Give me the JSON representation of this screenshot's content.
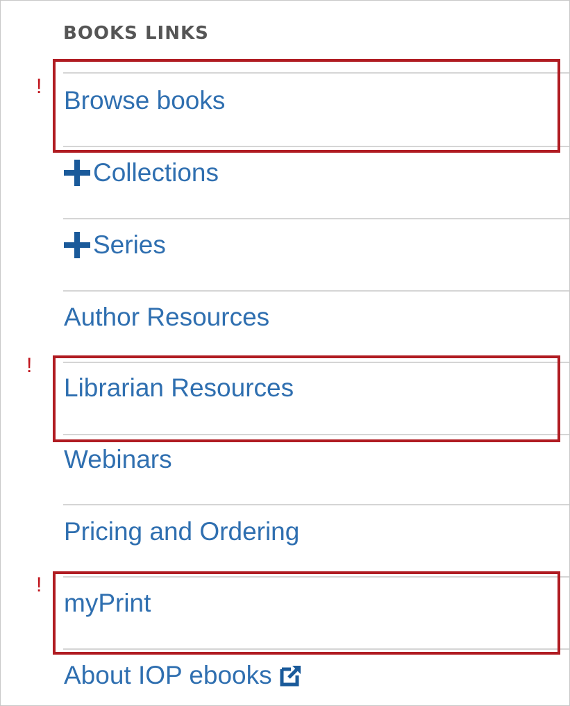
{
  "panel": {
    "heading": "BOOKS LINKS"
  },
  "nav": {
    "items": [
      {
        "label": "Browse books",
        "expandable": false,
        "external": false,
        "highlighted": true
      },
      {
        "label": "Collections",
        "expandable": true,
        "external": false,
        "highlighted": false
      },
      {
        "label": "Series",
        "expandable": true,
        "external": false,
        "highlighted": false
      },
      {
        "label": "Author Resources",
        "expandable": false,
        "external": false,
        "highlighted": false
      },
      {
        "label": "Librarian Resources",
        "expandable": false,
        "external": false,
        "highlighted": true
      },
      {
        "label": "Webinars",
        "expandable": false,
        "external": false,
        "highlighted": false
      },
      {
        "label": "Pricing and Ordering",
        "expandable": false,
        "external": false,
        "highlighted": false
      },
      {
        "label": "myPrint",
        "expandable": false,
        "external": false,
        "highlighted": true
      },
      {
        "label": "About IOP ebooks",
        "expandable": false,
        "external": true,
        "highlighted": false
      }
    ]
  },
  "annotations": {
    "marker": "!"
  },
  "colors": {
    "link": "#2f6fb0",
    "plus_icon": "#1a5a9a",
    "heading": "#555555",
    "divider": "#d5d5d5",
    "highlight_border": "#b01c22",
    "marker": "#c0141c"
  },
  "icons": {
    "expand": "plus-icon",
    "external": "external-link-icon"
  }
}
